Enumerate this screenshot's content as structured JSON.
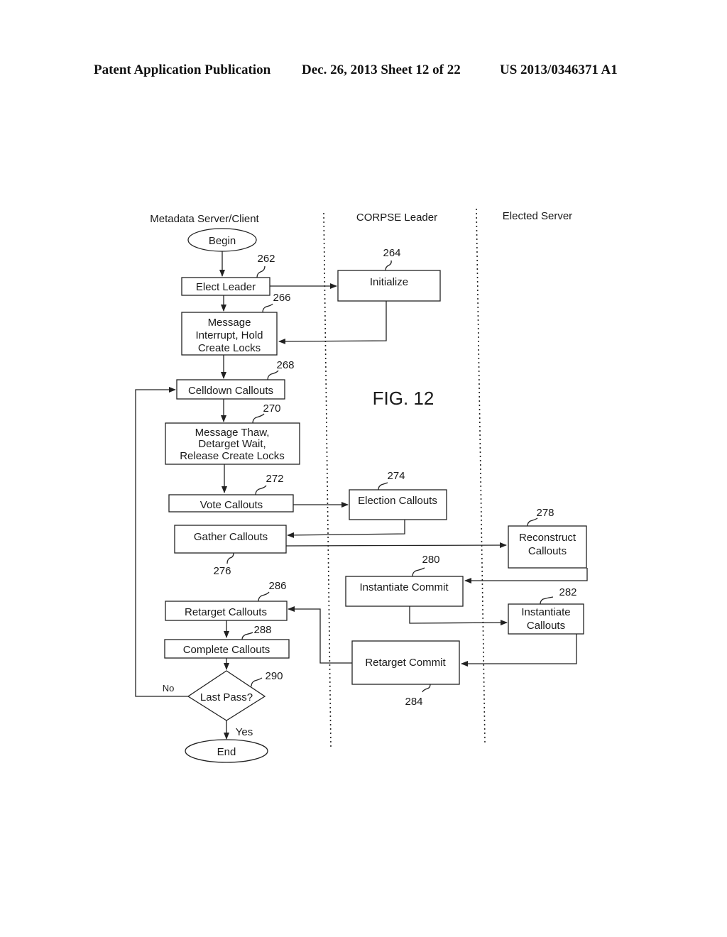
{
  "header": {
    "publication": "Patent Application Publication",
    "date_sheet": "Dec. 26, 2013   Sheet 12 of 22",
    "number": "US 2013/0346371 A1"
  },
  "figure": {
    "label": "FIG. 12"
  },
  "lanes": [
    {
      "id": "client",
      "title": "Metadata Server/Client"
    },
    {
      "id": "leader",
      "title": "CORPSE Leader"
    },
    {
      "id": "elected",
      "title": "Elected Server"
    }
  ],
  "nodes": {
    "begin": {
      "label": "Begin"
    },
    "elect_leader": {
      "label": "Elect Leader",
      "ref": "262"
    },
    "initialize": {
      "label": "Initialize",
      "ref": "264"
    },
    "message_interrupt": {
      "lines": [
        "Message",
        "Interrupt, Hold",
        "Create Locks"
      ],
      "ref": "266"
    },
    "celldown": {
      "label": "Celldown Callouts",
      "ref": "268"
    },
    "message_thaw": {
      "lines": [
        "Message Thaw,",
        "Detarget Wait,",
        "Release Create Locks"
      ],
      "ref": "270"
    },
    "vote": {
      "label": "Vote Callouts",
      "ref": "272"
    },
    "election": {
      "label": "Election Callouts",
      "ref": "274"
    },
    "gather": {
      "label": "Gather Callouts",
      "ref": "276"
    },
    "reconstruct": {
      "lines": [
        "Reconstruct",
        "Callouts"
      ],
      "ref": "278"
    },
    "instantiate_commit": {
      "label": "Instantiate Commit",
      "ref": "280"
    },
    "instantiate_callouts": {
      "lines": [
        "Instantiate",
        "Callouts"
      ],
      "ref": "282"
    },
    "retarget_commit": {
      "label": "Retarget Commit",
      "ref": "284"
    },
    "retarget_callouts": {
      "label": "Retarget Callouts",
      "ref": "286"
    },
    "complete": {
      "label": "Complete Callouts",
      "ref": "288"
    },
    "last_pass": {
      "label": "Last Pass?",
      "ref": "290"
    },
    "end": {
      "label": "End"
    }
  },
  "edge_labels": {
    "no": "No",
    "yes": "Yes"
  }
}
